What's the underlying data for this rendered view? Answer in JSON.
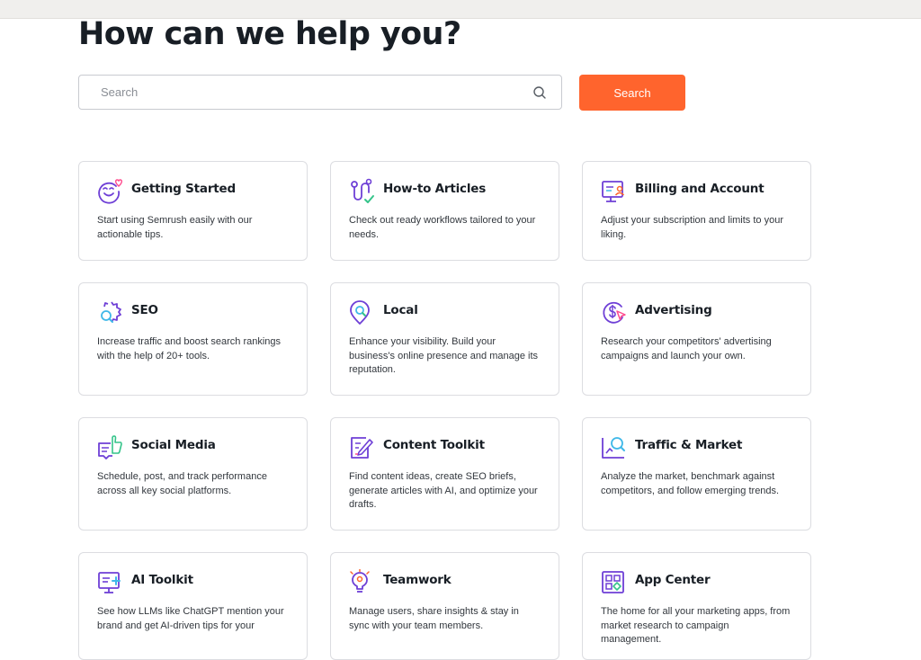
{
  "header": {
    "title": "How can we help you?"
  },
  "search": {
    "placeholder": "Search",
    "button_label": "Search"
  },
  "colors": {
    "accent": "#ff642d",
    "icon_purple": "#6e3fd6",
    "icon_pink": "#ff4a8d",
    "icon_cyan": "#3fb8e8",
    "icon_green": "#35c48a"
  },
  "categories": [
    {
      "title": "Getting Started",
      "description": "Start using Semrush easily with our actionable tips.",
      "icon": "smiley-heart-icon"
    },
    {
      "title": "How-to Articles",
      "description": "Check out ready workflows tailored to your needs.",
      "icon": "workflow-path-icon"
    },
    {
      "title": "Billing and Account",
      "description": "Adjust your subscription and limits to your liking.",
      "icon": "billing-account-icon"
    },
    {
      "title": "SEO",
      "description": "Increase traffic and boost search rankings with the help of 20+ tools.",
      "icon": "seo-gear-search-icon"
    },
    {
      "title": "Local",
      "description": "Enhance your visibility. Build your business's online presence and manage its reputation.",
      "icon": "map-pin-search-icon"
    },
    {
      "title": "Advertising",
      "description": "Research your competitors' advertising campaigns and launch your own.",
      "icon": "dollar-cursor-icon"
    },
    {
      "title": "Social Media",
      "description": "Schedule, post, and track performance across all key social platforms.",
      "icon": "thumbs-up-document-icon"
    },
    {
      "title": "Content Toolkit",
      "description": "Find content ideas, create SEO briefs, generate articles with AI, and optimize your drafts.",
      "icon": "content-pen-icon"
    },
    {
      "title": "Traffic & Market",
      "description": "Analyze the market, benchmark against competitors, and follow emerging trends.",
      "icon": "chart-magnifier-icon"
    },
    {
      "title": "AI Toolkit",
      "description": "See how LLMs like ChatGPT mention your brand and get AI-driven tips for your",
      "icon": "ai-monitor-icon"
    },
    {
      "title": "Teamwork",
      "description": "Manage users, share insights & stay in sync with your team members.",
      "icon": "lightbulb-people-icon"
    },
    {
      "title": "App Center",
      "description": "The home for all your marketing apps, from market research to campaign management.",
      "icon": "app-grid-icon"
    }
  ]
}
